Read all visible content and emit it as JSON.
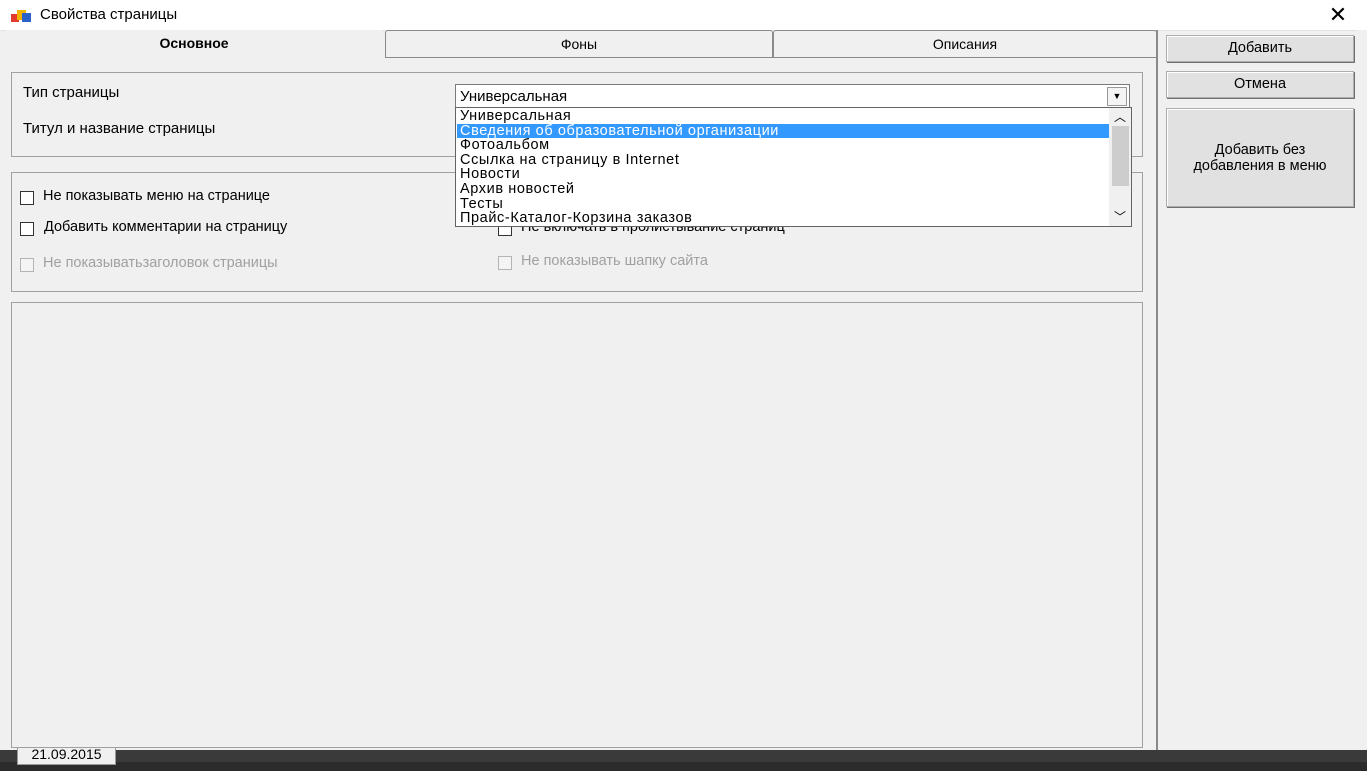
{
  "window": {
    "title": "Свойства страницы",
    "close_glyph": "✕"
  },
  "tabs": [
    {
      "label": "Основное",
      "active": true
    },
    {
      "label": "Фоны",
      "active": false
    },
    {
      "label": "Описания",
      "active": false
    }
  ],
  "fields": {
    "page_type_label": "Тип страницы",
    "page_title_label": "Титул и название страницы",
    "page_type_value": "Универсальная"
  },
  "dropdown": {
    "options": [
      "Универсальная",
      "Сведения об образовательной организации",
      "Фотоальбом",
      "Ссылка на страницу в Internet",
      "Новости",
      "Архив новостей",
      "Тесты",
      "Прайс-Каталог-Корзина заказов"
    ],
    "highlighted": "Сведения об образовательной организации"
  },
  "checkboxes": [
    {
      "label": "Не показывать меню на странице",
      "checked": false,
      "enabled": true
    },
    {
      "label": "Добавить комментарии на страницу",
      "checked": false,
      "enabled": true
    },
    {
      "label": "Не показыватьзаголовок страницы",
      "checked": false,
      "enabled": false
    },
    {
      "label": "Не включать в пролистывание страниц",
      "checked": false,
      "enabled": true
    },
    {
      "label": "Не показывать шапку сайта",
      "checked": false,
      "enabled": false
    }
  ],
  "buttons": {
    "add": "Добавить",
    "cancel": "Отмена",
    "add_no_menu": "Добавить без добавления в меню"
  },
  "background": {
    "date": "21.09.2015"
  },
  "icons": {
    "app": "app-logo-icon",
    "close": "close-icon",
    "combo_arrow": "chevron-down-icon"
  },
  "colors": {
    "selection": "#3399ff",
    "disabled_text": "#a0a0a0"
  }
}
